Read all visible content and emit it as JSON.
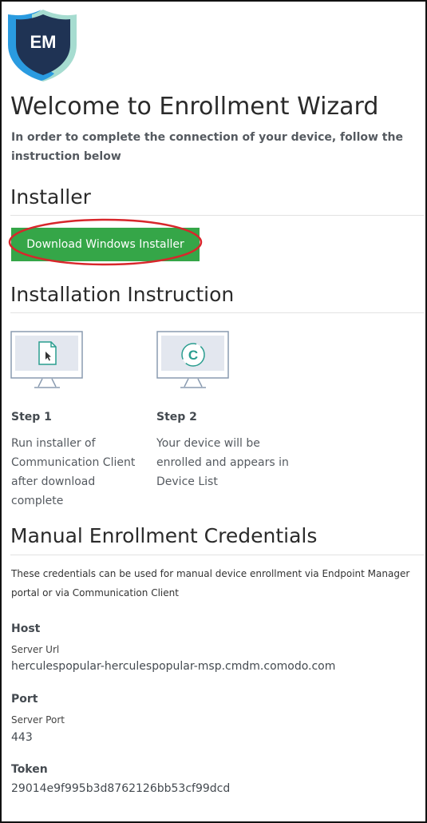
{
  "logo": {
    "text": "EM"
  },
  "page": {
    "title": "Welcome to Enrollment Wizard",
    "intro": "In order to complete the connection of your device, follow the instruction below"
  },
  "installer": {
    "heading": "Installer",
    "button_label": "Download Windows Installer"
  },
  "instruction": {
    "heading": "Installation Instruction",
    "steps": [
      {
        "title": "Step 1",
        "text": "Run installer of Communication Client after download complete",
        "icon": "installer-file-icon"
      },
      {
        "title": "Step 2",
        "text": "Your device will be enrolled and appears in Device List",
        "icon": "comodo-client-icon"
      }
    ]
  },
  "credentials": {
    "heading": "Manual Enrollment Credentials",
    "description": "These credentials can be used for manual device enrollment via Endpoint Manager portal or via Communication Client",
    "host": {
      "label": "Host",
      "sublabel": "Server Url",
      "value": "herculespopular-herculespopular-msp.cmdm.comodo.com"
    },
    "port": {
      "label": "Port",
      "sublabel": "Server Port",
      "value": "443"
    },
    "token": {
      "label": "Token",
      "value": "29014e9f995b3d8762126bb53cf99dcd"
    }
  },
  "colors": {
    "button_green": "#35a648",
    "highlight_red": "#d8262b",
    "shield_blue": "#2a9be0",
    "shield_navy": "#1f3354"
  }
}
